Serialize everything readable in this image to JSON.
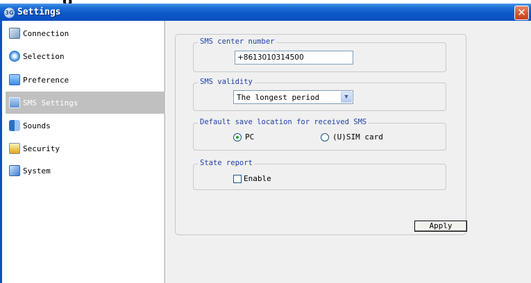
{
  "window": {
    "clipped_heading": "g",
    "app_icon_text": "3G",
    "title": "Settings",
    "close_label": "✕"
  },
  "sidebar": {
    "items": [
      {
        "label": "Connection",
        "icon": "connection-icon",
        "active": false
      },
      {
        "label": "Selection",
        "icon": "selection-icon",
        "active": false
      },
      {
        "label": "Preference",
        "icon": "preference-icon",
        "active": false
      },
      {
        "label": "SMS Settings",
        "icon": "sms-settings-icon",
        "active": true
      },
      {
        "label": "Sounds",
        "icon": "sounds-icon",
        "active": false
      },
      {
        "label": "Security",
        "icon": "security-icon",
        "active": false
      },
      {
        "label": "System",
        "icon": "system-icon",
        "active": false
      }
    ]
  },
  "sms_center": {
    "legend": "SMS center number",
    "value": "+8613010314500"
  },
  "sms_validity": {
    "legend": "SMS validity",
    "selected": "The longest period"
  },
  "save_location": {
    "legend": "Default save location for received SMS",
    "options": [
      {
        "label": "PC",
        "checked": true
      },
      {
        "label": "(U)SIM card",
        "checked": false
      }
    ]
  },
  "state_report": {
    "legend": "State report",
    "checkbox_label": "Enable",
    "checked": false
  },
  "actions": {
    "apply_label": "Apply"
  },
  "colors": {
    "titlebar": "#0b58c9",
    "active_item_bg": "#c0c0c0",
    "legend_text": "#1f3fa8",
    "close_button": "#d8532a"
  }
}
